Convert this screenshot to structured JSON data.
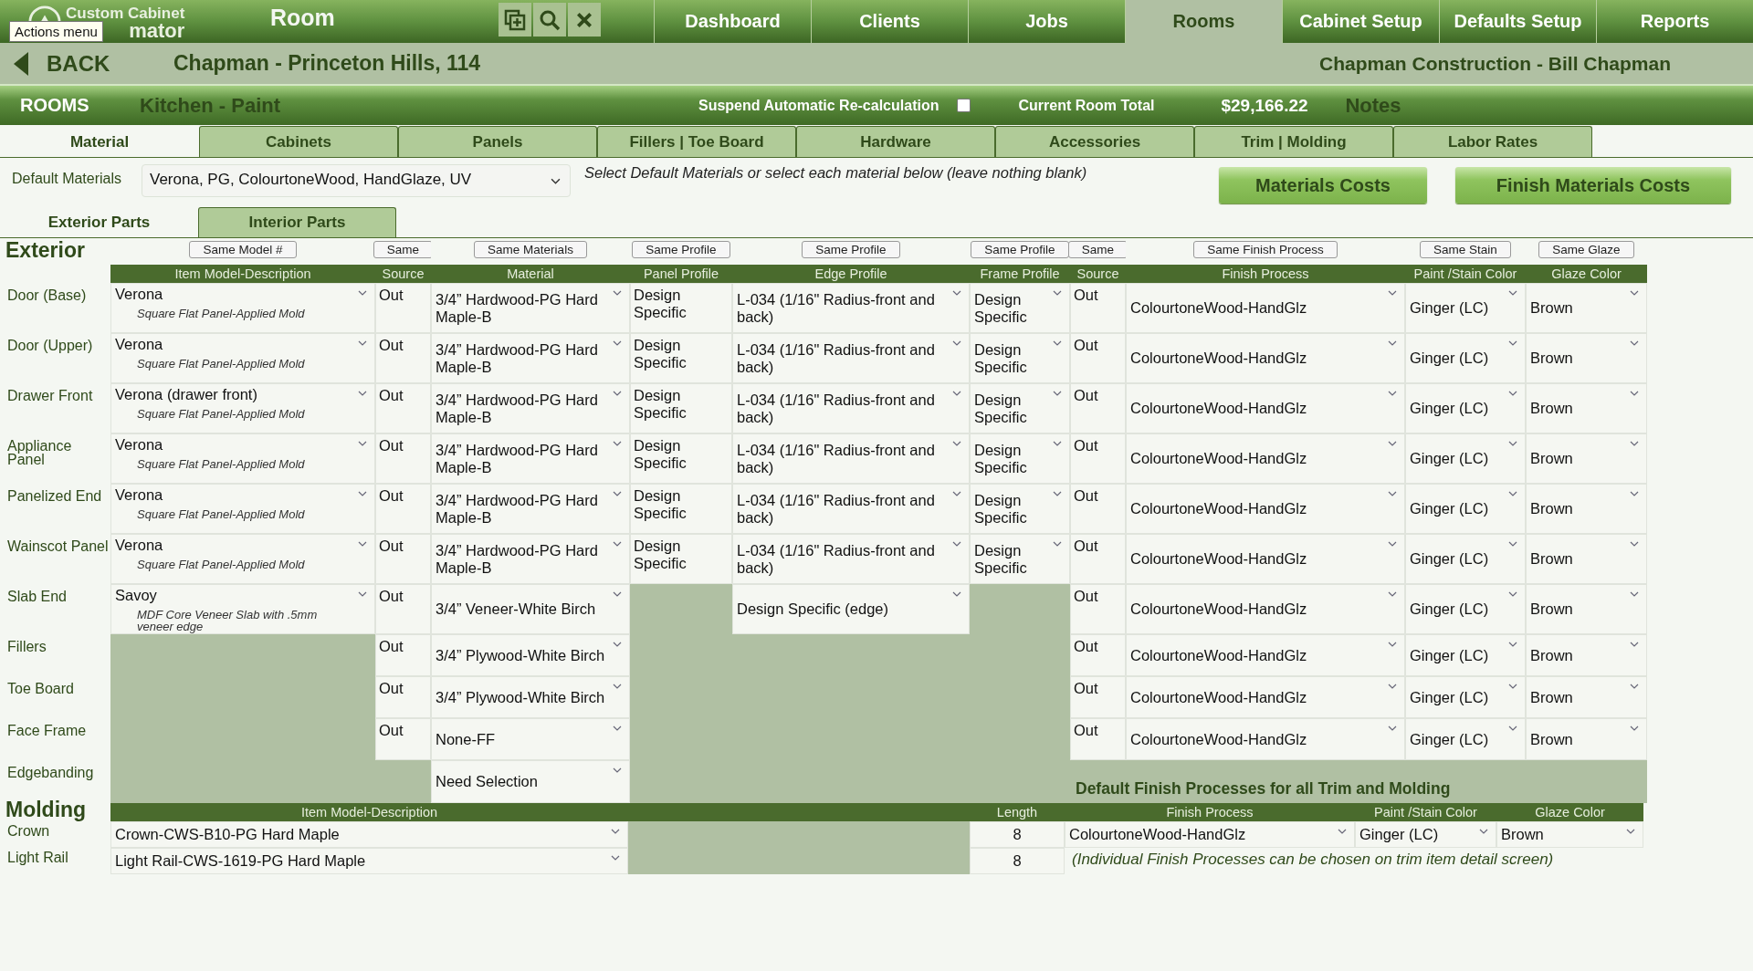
{
  "app": {
    "logo_line1": "Custom Cabinet",
    "logo_line2": "mator",
    "tooltip": "Actions menu",
    "title": "Room"
  },
  "nav": [
    {
      "label": "Dashboard",
      "selected": false
    },
    {
      "label": "Clients",
      "selected": false
    },
    {
      "label": "Jobs",
      "selected": false
    },
    {
      "label": "Rooms",
      "selected": true
    },
    {
      "label": "Cabinet Setup",
      "selected": false
    },
    {
      "label": "Defaults Setup",
      "selected": false
    },
    {
      "label": "Reports",
      "selected": false
    }
  ],
  "job_bar": {
    "back": "BACK",
    "job": "Chapman - Princeton Hills, 114",
    "client": "Chapman Construction - Bill Chapman"
  },
  "room_bar": {
    "section": "ROOMS",
    "room": "Kitchen - Paint",
    "suspend_label": "Suspend Automatic Re-calculation",
    "suspend_checked": false,
    "total_label": "Current Room Total",
    "total": "$29,166.22",
    "notes": "Notes"
  },
  "tabs": [
    {
      "label": "Material",
      "selected": true
    },
    {
      "label": "Cabinets",
      "selected": false
    },
    {
      "label": "Panels",
      "selected": false
    },
    {
      "label": "Fillers | Toe Board",
      "selected": false
    },
    {
      "label": "Hardware",
      "selected": false
    },
    {
      "label": "Accessories",
      "selected": false
    },
    {
      "label": "Trim | Molding",
      "selected": false
    },
    {
      "label": "Labor Rates",
      "selected": false
    }
  ],
  "defaults": {
    "label": "Default Materials",
    "value": "Verona, PG, ColourtoneWood, HandGlaze, UV",
    "hint": "Select Default Materials or select each material below (leave nothing blank)",
    "buttons": [
      "Materials Costs",
      "Finish Materials Costs"
    ]
  },
  "part_tabs": [
    {
      "label": "Exterior Parts",
      "selected": true
    },
    {
      "label": "Interior Parts",
      "selected": false
    }
  ],
  "exterior": {
    "heading": "Exterior",
    "same_buttons": [
      "Same Model #",
      "Same",
      "Same Materials",
      "Same Profile",
      "Same Profile",
      "Same Profile",
      "Same",
      "Same Finish Process",
      "Same Stain",
      "Same Glaze"
    ],
    "columns": [
      "Item Model-Description",
      "Source",
      "Material",
      "Panel Profile",
      "Edge Profile",
      "Frame Profile",
      "Source",
      "Finish Process",
      "Paint /Stain Color",
      "Glaze Color"
    ],
    "rows": [
      {
        "label": "Door (Base)",
        "model": {
          "value": "Verona",
          "description": "Square Flat Panel-Applied Mold"
        },
        "source": "Out",
        "material": "3/4” Hardwood-PG Hard Maple-B",
        "panel_profile": "Design Specific",
        "edge_profile": "L-034 (1/16\" Radius-front and back)",
        "frame_profile": "Design Specific",
        "finish_source": "Out",
        "finish_process": "ColourtoneWood-HandGlz",
        "paint_color": "Ginger (LC)",
        "glaze_color": "Brown"
      },
      {
        "label": "Door (Upper)",
        "model": {
          "value": "Verona",
          "description": "Square Flat Panel-Applied Mold"
        },
        "source": "Out",
        "material": "3/4” Hardwood-PG Hard Maple-B",
        "panel_profile": "Design Specific",
        "edge_profile": "L-034 (1/16\" Radius-front and back)",
        "frame_profile": "Design Specific",
        "finish_source": "Out",
        "finish_process": "ColourtoneWood-HandGlz",
        "paint_color": "Ginger (LC)",
        "glaze_color": "Brown"
      },
      {
        "label": "Drawer Front",
        "model": {
          "value": "Verona (drawer front)",
          "description": "Square Flat Panel-Applied Mold"
        },
        "source": "Out",
        "material": "3/4” Hardwood-PG Hard Maple-B",
        "panel_profile": "Design Specific",
        "edge_profile": "L-034 (1/16\" Radius-front and back)",
        "frame_profile": "Design Specific",
        "finish_source": "Out",
        "finish_process": "ColourtoneWood-HandGlz",
        "paint_color": "Ginger (LC)",
        "glaze_color": "Brown"
      },
      {
        "label": "Appliance Panel",
        "model": {
          "value": "Verona",
          "description": "Square Flat Panel-Applied Mold"
        },
        "source": "Out",
        "material": "3/4” Hardwood-PG Hard Maple-B",
        "panel_profile": "Design Specific",
        "edge_profile": "L-034 (1/16\" Radius-front and back)",
        "frame_profile": "Design Specific",
        "finish_source": "Out",
        "finish_process": "ColourtoneWood-HandGlz",
        "paint_color": "Ginger (LC)",
        "glaze_color": "Brown"
      },
      {
        "label": "Panelized End",
        "model": {
          "value": "Verona",
          "description": "Square Flat Panel-Applied Mold"
        },
        "source": "Out",
        "material": "3/4” Hardwood-PG Hard Maple-B",
        "panel_profile": "Design Specific",
        "edge_profile": "L-034 (1/16\" Radius-front and back)",
        "frame_profile": "Design Specific",
        "finish_source": "Out",
        "finish_process": "ColourtoneWood-HandGlz",
        "paint_color": "Ginger (LC)",
        "glaze_color": "Brown"
      },
      {
        "label": "Wainscot Panel",
        "model": {
          "value": "Verona",
          "description": "Square Flat Panel-Applied Mold"
        },
        "source": "Out",
        "material": "3/4” Hardwood-PG Hard Maple-B",
        "panel_profile": "Design Specific",
        "edge_profile": "L-034 (1/16\" Radius-front and back)",
        "frame_profile": "Design Specific",
        "finish_source": "Out",
        "finish_process": "ColourtoneWood-HandGlz",
        "paint_color": "Ginger (LC)",
        "glaze_color": "Brown"
      },
      {
        "label": "Slab End",
        "model": {
          "value": "Savoy",
          "description": "MDF Core Veneer Slab with .5mm veneer edge"
        },
        "source": "Out",
        "material": "3/4” Veneer-White Birch",
        "edge_profile": "Design Specific (edge)",
        "finish_source": "Out",
        "finish_process": "ColourtoneWood-HandGlz",
        "paint_color": "Ginger (LC)",
        "glaze_color": "Brown"
      },
      {
        "label": "Fillers",
        "source": "Out",
        "material": "3/4” Plywood-White Birch",
        "finish_source": "Out",
        "finish_process": "ColourtoneWood-HandGlz",
        "paint_color": "Ginger (LC)",
        "glaze_color": "Brown"
      },
      {
        "label": "Toe Board",
        "source": "Out",
        "material": "3/4” Plywood-White Birch",
        "finish_source": "Out",
        "finish_process": "ColourtoneWood-HandGlz",
        "paint_color": "Ginger (LC)",
        "glaze_color": "Brown"
      },
      {
        "label": "Face Frame",
        "source": "Out",
        "material": "None-FF",
        "finish_source": "Out",
        "finish_process": "ColourtoneWood-HandGlz",
        "paint_color": "Ginger (LC)",
        "glaze_color": "Brown"
      },
      {
        "label": "Edgebanding",
        "material": "Need Selection",
        "note": "Default Finish Processes for all Trim and Molding"
      }
    ]
  },
  "molding": {
    "heading": "Molding",
    "columns": [
      "Item Model-Description",
      "Length",
      "Finish Process",
      "Paint /Stain Color",
      "Glaze Color"
    ],
    "rows": [
      {
        "label": "Crown",
        "model": "Crown-CWS-B10-PG Hard Maple",
        "length": "8",
        "finish_process": "ColourtoneWood-HandGlz",
        "paint_color": "Ginger (LC)",
        "glaze_color": "Brown"
      },
      {
        "label": "Light Rail",
        "model": "Light Rail-CWS-1619-PG Hard Maple",
        "length": "8",
        "note": "(Individual Finish Processes can be chosen on trim item detail screen)"
      }
    ]
  }
}
